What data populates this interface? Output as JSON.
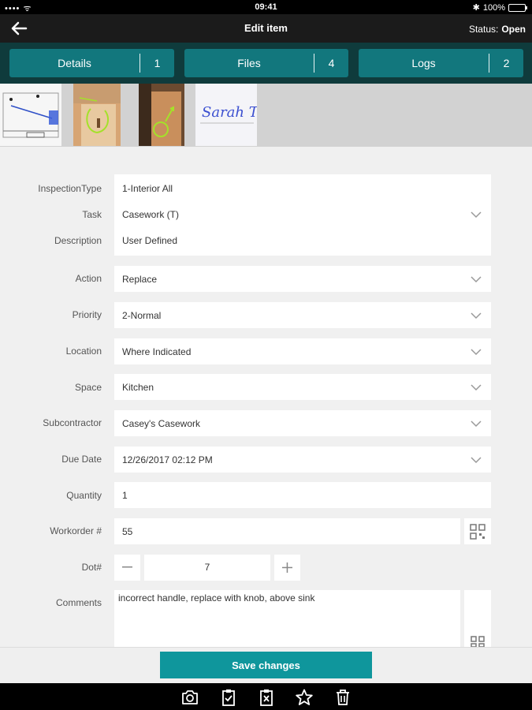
{
  "status_bar": {
    "time": "09:41",
    "battery": "100%"
  },
  "header": {
    "title": "Edit item",
    "status_label": "Status:",
    "status_value": "Open"
  },
  "tabs": [
    {
      "label": "Details",
      "count": "1"
    },
    {
      "label": "Files",
      "count": "4"
    },
    {
      "label": "Logs",
      "count": "2"
    }
  ],
  "thumbnails": {
    "signature_text": "Sarah T"
  },
  "form": {
    "inspection_type": {
      "label": "InspectionType",
      "value": "1-Interior All"
    },
    "task": {
      "label": "Task",
      "value": "Casework (T)"
    },
    "description": {
      "label": "Description",
      "value": "User Defined"
    },
    "action": {
      "label": "Action",
      "value": "Replace"
    },
    "priority": {
      "label": "Priority",
      "value": "2-Normal"
    },
    "location": {
      "label": "Location",
      "value": "Where Indicated"
    },
    "space": {
      "label": "Space",
      "value": "Kitchen"
    },
    "subcontractor": {
      "label": "Subcontractor",
      "value": "Casey's Casework"
    },
    "due_date": {
      "label": "Due Date",
      "value": "12/26/2017 02:12 PM"
    },
    "quantity": {
      "label": "Quantity",
      "value": "1"
    },
    "workorder": {
      "label": "Workorder #",
      "value": "55"
    },
    "dot": {
      "label": "Dot#",
      "value": "7"
    },
    "comments": {
      "label": "Comments",
      "value": "incorrect handle, replace with knob, above sink"
    }
  },
  "footer": {
    "save_label": "Save changes"
  },
  "toolbar_icons": [
    "camera-icon",
    "clipboard-check-icon",
    "clipboard-x-icon",
    "star-icon",
    "trash-icon"
  ]
}
